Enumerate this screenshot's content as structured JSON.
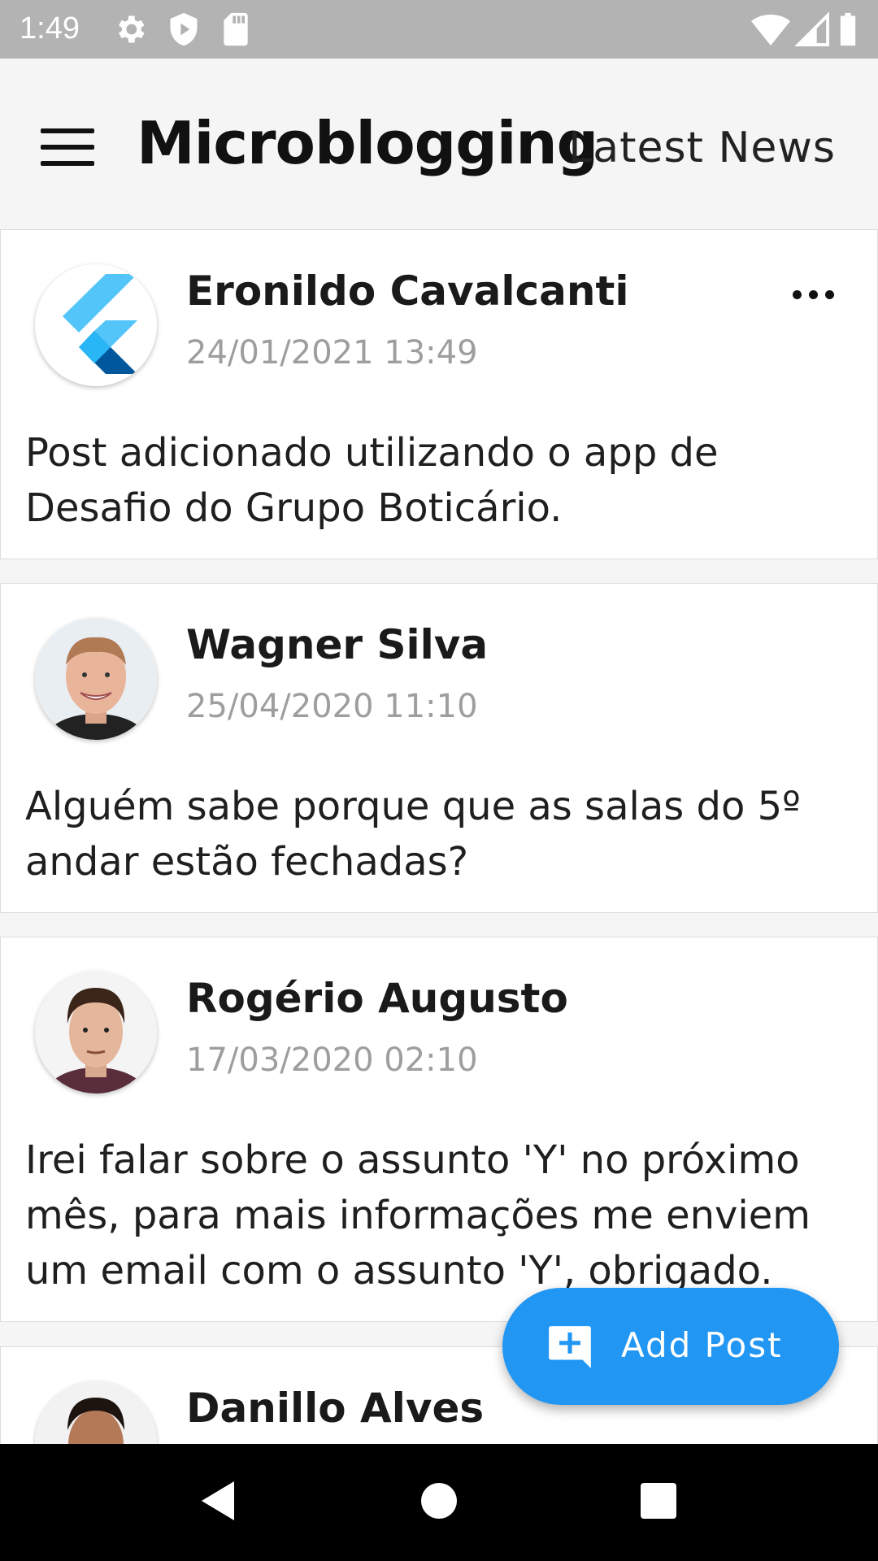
{
  "status_bar": {
    "time": "1:49",
    "left_icons": [
      "gear-icon",
      "shield-play-icon",
      "sd-card-icon"
    ],
    "right_icons": [
      "wifi-icon",
      "signal-icon",
      "battery-icon"
    ]
  },
  "app_bar": {
    "menu_icon": "hamburger-menu-icon",
    "title": "Microblogging",
    "subtitle": "Latest News"
  },
  "posts": [
    {
      "author": "Eronildo Cavalcanti",
      "date": "24/01/2021 13:49",
      "text": "Post adicionado utilizando o app de Desafio do Grupo Boticário.",
      "avatar": "flutter-logo-icon",
      "has_menu": true
    },
    {
      "author": "Wagner Silva",
      "date": "25/04/2020 11:10",
      "text": "Alguém sabe porque que as salas do 5º andar estão fechadas?",
      "avatar": "user-photo"
    },
    {
      "author": "Rogério Augusto",
      "date": "17/03/2020 02:10",
      "text": "Irei falar sobre o assunto 'Y' no próximo mês, para mais informações me enviem um email com o assunto 'Y', obrigado.",
      "avatar": "user-photo"
    },
    {
      "author": "Danillo Alves",
      "avatar": "user-photo"
    }
  ],
  "fab": {
    "label": "Add Post",
    "icon": "add-comment-icon"
  },
  "colors": {
    "accent": "#2196f3",
    "status_bar": "#b3b3b3",
    "background": "#f5f5f5"
  }
}
